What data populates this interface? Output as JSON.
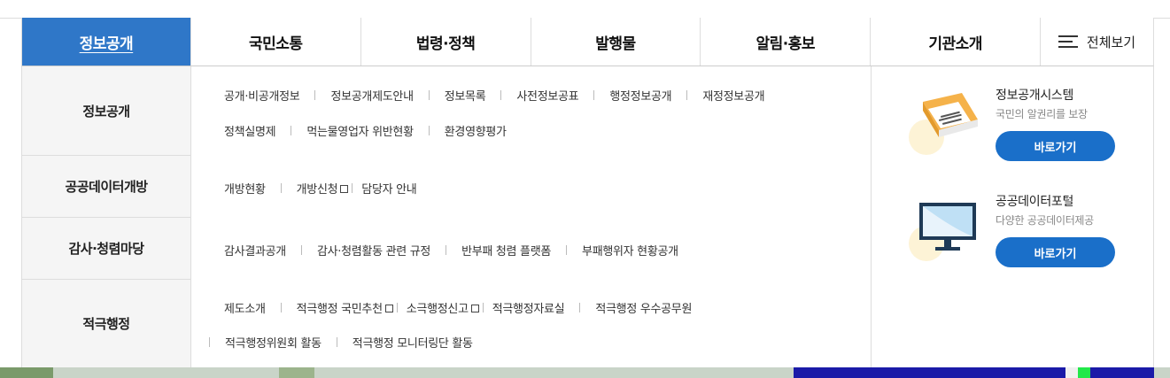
{
  "gnb": {
    "items": [
      {
        "label": "정보공개",
        "active": true
      },
      {
        "label": "국민소통"
      },
      {
        "label": "법령·정책"
      },
      {
        "label": "발행물"
      },
      {
        "label": "알림·홍보"
      },
      {
        "label": "기관소개"
      }
    ],
    "all_menu_label": "전체보기",
    "active_color": "#2f77c8"
  },
  "categories": [
    {
      "label": "정보공개"
    },
    {
      "label": "공공데이터개방"
    },
    {
      "label": "감사·청렴마당"
    },
    {
      "label": "적극행정"
    }
  ],
  "links": {
    "info_disclosure_row1": [
      "공개·비공개정보",
      "정보공개제도안내",
      "정보목록",
      "사전정보공표",
      "행정정보공개",
      "재정정보공개"
    ],
    "info_disclosure_row2": [
      "정책실명제",
      "먹는물영업자 위반현황",
      "환경영향평가"
    ],
    "open_data": [
      "개방현황",
      "개방신청",
      "담당자 안내"
    ],
    "audit": [
      "감사결과공개",
      "감사·청렴활동 관련 규정",
      "반부패 청렴 플랫폼",
      "부패행위자 현황공개"
    ],
    "proactive_row1": [
      "제도소개",
      "적극행정 국민추천",
      "소극행정신고",
      "적극행정자료실",
      "적극행정 우수공무원"
    ],
    "proactive_row2": [
      "적극행정위원회 활동",
      "적극행정 모니터링단 활동"
    ]
  },
  "promos": [
    {
      "title": "정보공개시스템",
      "subtitle": "국민의 알권리를 보장",
      "button": "바로가기",
      "icon": "book-icon"
    },
    {
      "title": "공공데이터포털",
      "subtitle": "다양한 공공데이터제공",
      "button": "바로가기",
      "icon": "monitor-icon"
    }
  ],
  "colors": {
    "button": "#1a6fc9",
    "category_bg": "#f5f5f5"
  }
}
